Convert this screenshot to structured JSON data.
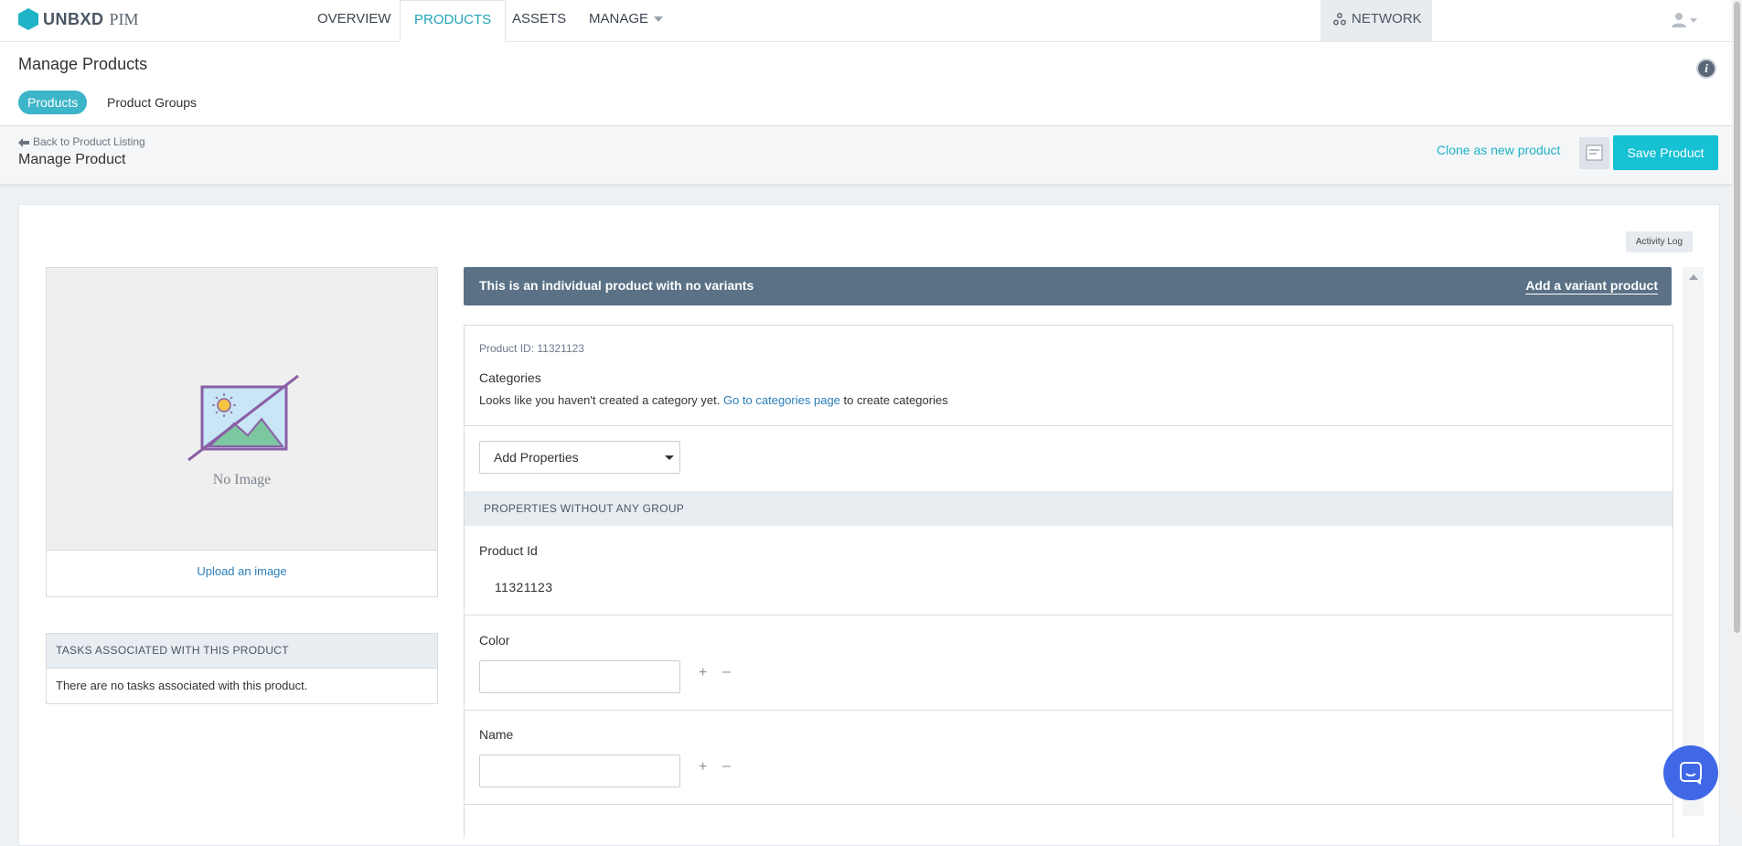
{
  "nav": {
    "brand": "UNBXD",
    "brand_suffix": "PIM",
    "tabs": [
      {
        "label": "OVERVIEW"
      },
      {
        "label": "PRODUCTS"
      },
      {
        "label": "ASSETS"
      },
      {
        "label": "MANAGE"
      }
    ],
    "active_tab": "PRODUCTS",
    "network_label": "NETWORK",
    "user_icon": "user-icon"
  },
  "page": {
    "title": "Manage Products",
    "subtabs": [
      {
        "label": "Products",
        "active": true
      },
      {
        "label": "Product Groups",
        "active": false
      }
    ]
  },
  "actionbar": {
    "back_label": "Back to Product Listing",
    "title": "Manage Product",
    "clone_label": "Clone as new product",
    "save_label": "Save Product"
  },
  "activity_label": "Activity Log",
  "image": {
    "placeholder_text": "No Image",
    "upload_label": "Upload an image"
  },
  "tasks": {
    "header": "TASKS ASSOCIATED WITH THIS PRODUCT",
    "empty_text": "There are no tasks associated with this product."
  },
  "banner": {
    "text": "This is an individual product with no variants",
    "link": "Add a variant product"
  },
  "product": {
    "id_label": "Product ID: 11321123",
    "categories_title": "Categories",
    "categories_text_before": "Looks like you haven't created a category yet.",
    "categories_link": "Go to categories page",
    "categories_text_after": "to create categories",
    "add_properties_label": "Add Properties",
    "group_header": "PROPERTIES WITHOUT ANY GROUP",
    "fields": [
      {
        "label": "Product Id",
        "value": "11321123"
      },
      {
        "label": "Color",
        "value": ""
      },
      {
        "label": "Name",
        "value": ""
      }
    ]
  },
  "colors": {
    "accent": "#16c1d3",
    "active_tab": "#1fa3b8",
    "banner": "#5a7186",
    "link": "#2a7eb8",
    "chat": "#3f67e6"
  }
}
